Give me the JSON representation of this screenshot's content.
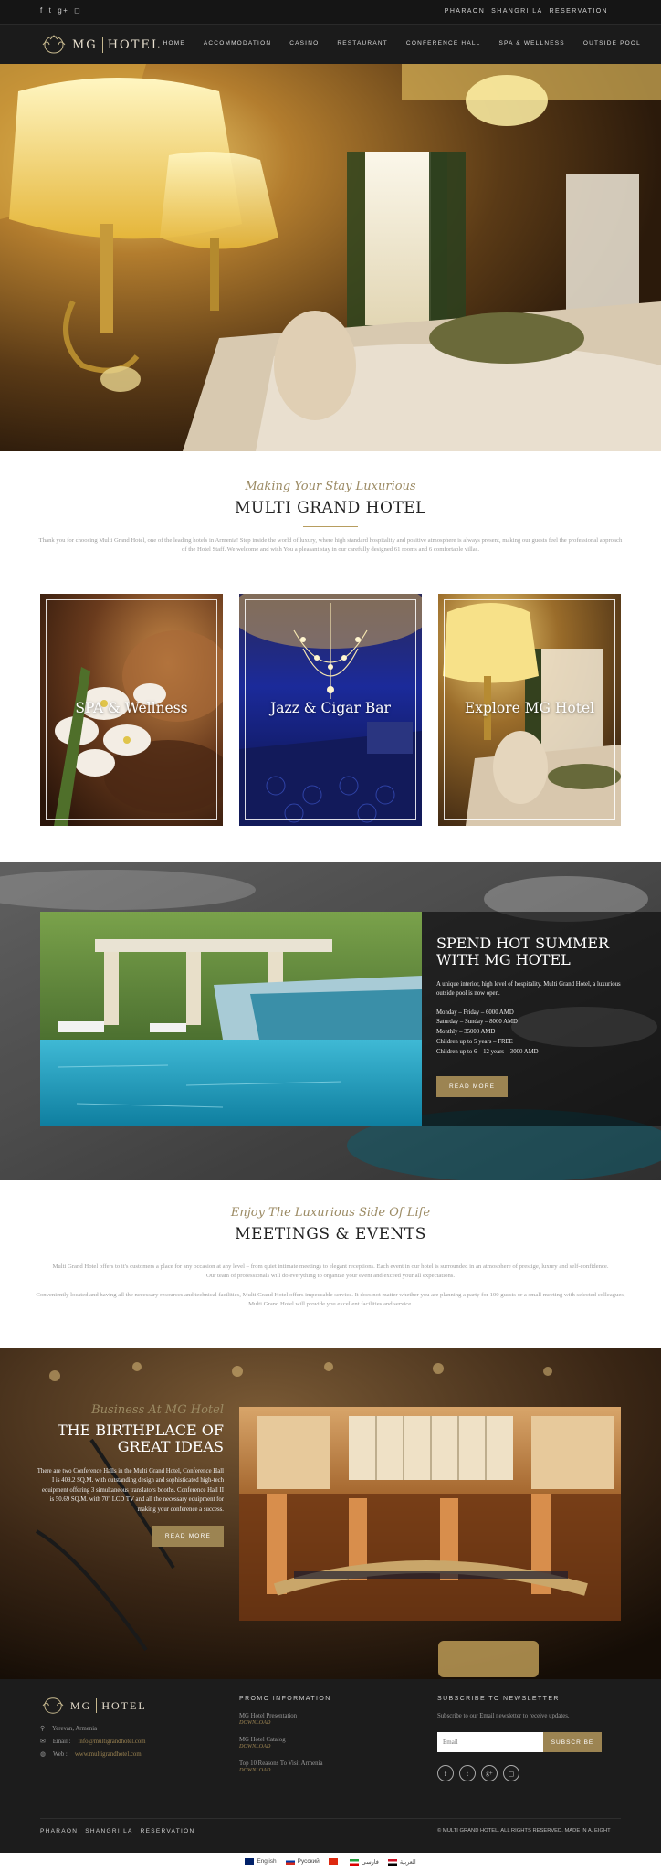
{
  "topbar": {
    "social_icons": [
      "facebook-icon",
      "twitter-icon",
      "google-plus-icon",
      "instagram-icon"
    ],
    "links": [
      "PHARAON",
      "SHANGRI LA",
      "RESERVATION"
    ]
  },
  "brand": {
    "left": "MG",
    "right": "HOTEL"
  },
  "menu": [
    "HOME",
    "ACCOMMODATION",
    "CASINO",
    "RESTAURANT",
    "CONFERENCE HALL",
    "SPA & WELLNESS",
    "OUTSIDE POOL"
  ],
  "intro": {
    "kicker": "Making Your Stay Luxurious",
    "title": "MULTI GRAND HOTEL",
    "text": "Thank you for choosing Multi Grand Hotel, one of the leading hotels in Armenia! Step inside the world of luxury, where high standard hospitality and positive atmosphere is always present, making our guests feel the professional approach of the Hotel Staff. We welcome and wish You a pleasant stay in our carefully designed 61 rooms and 6 comfortable villas."
  },
  "cards": [
    {
      "title": "SPA & Wellness"
    },
    {
      "title": "Jazz & Cigar Bar"
    },
    {
      "title": "Explore MG Hotel"
    }
  ],
  "summer": {
    "title_line1": "SPEND HOT SUMMER",
    "title_line2": "WITH MG HOTEL",
    "text": "A unique interior, high level of hospitality. Multi Grand Hotel, a luxurious outside pool is now open.",
    "prices": [
      "Monday – Friday – 6000 AMD",
      "Saturday – Sunday – 8000 AMD",
      "Monthly – 35000 AMD",
      "Children up to 5 years – FREE",
      "Children up to 6 – 12 years – 3000 AMD"
    ],
    "button": "READ MORE"
  },
  "events": {
    "kicker": "Enjoy The Luxurious Side Of Life",
    "title": "MEETINGS & EVENTS",
    "text1": "Multi Grand Hotel offers to it's customers a place for any occasion at any level – from quiet intimate meetings to elegant receptions. Each event in our hotel is surrounded in an atmosphere of prestige, luxury and self-confidence. Our team of professionals will do everything to organize your event and exceed your all expectations.",
    "text2": "Conveniently located and having all the necessary resources and technical facilities, Multi Grand Hotel offers impeccable service. It does not matter whether you are planning a party for 100 guests or a small meeting with selected colleagues, Multi Grand Hotel will provide you excellent facilities and service."
  },
  "business": {
    "kicker": "Business At MG Hotel",
    "title_line1": "THE BIRTHPLACE OF",
    "title_line2": "GREAT IDEAS",
    "text": "There are two Conference Halls in the Multi Grand Hotel, Conference Hall I is 409.2 SQ.M. with outstanding design and sophisticated high-tech equipment offering 3 simultaneous translators booths. Conference Hall II is 50.69 SQ.M. with 70\" LCD TV and all the necessary equipment for making your conference a success.",
    "button": "READ MORE"
  },
  "footer": {
    "address": "Yerevan, Armenia",
    "email_label": "Email :",
    "email": "info@multigrandhotel.com",
    "web_label": "Web :",
    "web": "www.multigrandhotel.com",
    "promo_title": "PROMO INFORMATION",
    "promos": [
      {
        "name": "MG Hotel Presentation",
        "action": "DOWNLOAD"
      },
      {
        "name": "MG Hotel Catalog",
        "action": "DOWNLOAD"
      },
      {
        "name": "Top 10 Reasons To Visit Armenia",
        "action": "DOWNLOAD"
      }
    ],
    "news_title": "SUBSCRIBE TO NEWSLETTER",
    "news_text": "Subscribe to our Email newsletter to receive updates.",
    "email_placeholder": "Email",
    "subscribe": "SUBSCRIBE",
    "social_icons": [
      "facebook-icon",
      "twitter-icon",
      "google-plus-icon",
      "instagram-icon"
    ],
    "bottom_links": [
      "PHARAON",
      "SHANGRI LA",
      "RESERVATION"
    ],
    "copyright": "© MULTI GRAND HOTEL. ALL RIGHTS RESERVED. MADE IN A. EIGHT"
  },
  "languages": [
    {
      "label": "English",
      "flag": "uk"
    },
    {
      "label": "Русский",
      "flag": "ru"
    },
    {
      "label": "",
      "flag": "cn"
    },
    {
      "label": "فارسی",
      "flag": "ir"
    },
    {
      "label": "العربية",
      "flag": "ar"
    }
  ],
  "colors": {
    "gold": "#9c8452",
    "dark": "#1b1b1b",
    "text_gray": "#9c9c9c"
  }
}
